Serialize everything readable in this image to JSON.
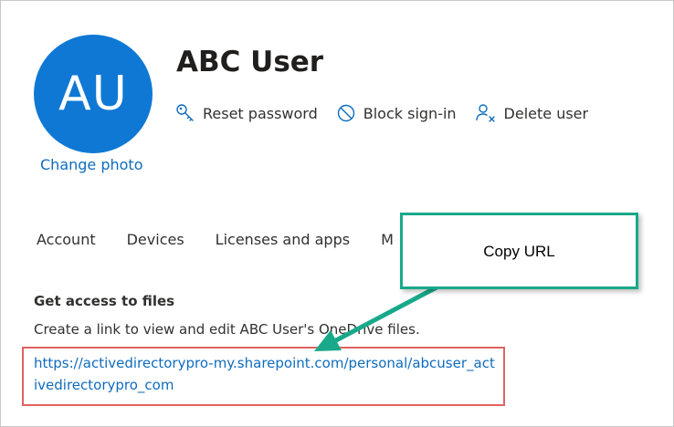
{
  "user": {
    "initials": "AU",
    "name": "ABC User",
    "change_photo_label": "Change photo"
  },
  "actions": [
    {
      "label": "Reset password",
      "icon": "key-icon"
    },
    {
      "label": "Block sign-in",
      "icon": "block-icon"
    },
    {
      "label": "Delete user",
      "icon": "delete-user-icon"
    }
  ],
  "tabs": [
    {
      "label": "Account"
    },
    {
      "label": "Devices"
    },
    {
      "label": "Licenses and apps"
    },
    {
      "label": "M"
    }
  ],
  "files": {
    "title": "Get access to files",
    "description": "Create a link to view and edit ABC User's OneDrive files.",
    "url": "https://activedirectorypro-my.sharepoint.com/personal/abcuser_activedirectorypro_com"
  },
  "callout": {
    "text": "Copy URL"
  },
  "colors": {
    "avatar": "#0f78d4",
    "link": "#0f6cbd",
    "callout_border": "#19a98a",
    "arrow": "#19a98a",
    "highlight_box": "#e06262"
  }
}
